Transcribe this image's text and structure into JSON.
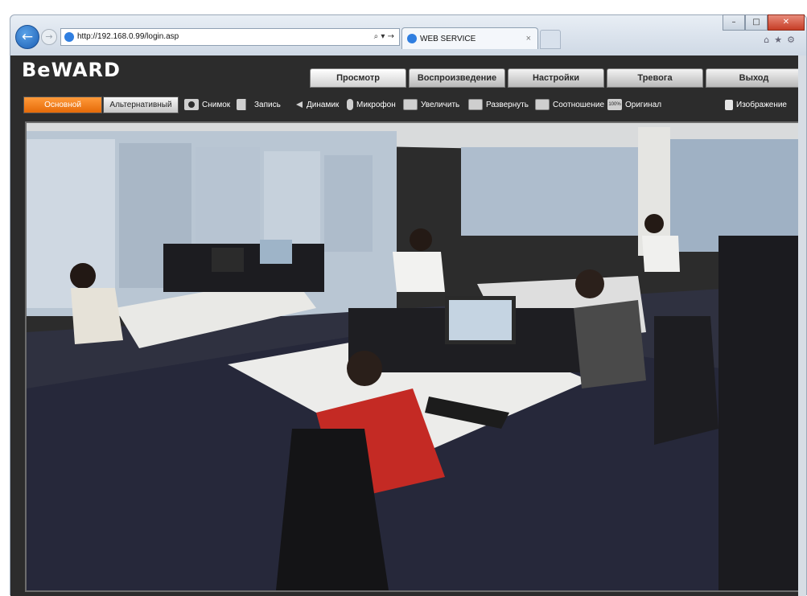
{
  "browser": {
    "url": "http://192.168.0.99/login.asp",
    "address_controls": "⌕ ▾ →",
    "tab_title": "WEB SERVICE",
    "tab_close": "×"
  },
  "app": {
    "logo": "BeWARD",
    "nav_tabs": [
      {
        "label": "Просмотр",
        "active": true
      },
      {
        "label": "Воспроизведение",
        "active": false
      },
      {
        "label": "Настройки",
        "active": false
      },
      {
        "label": "Тревога",
        "active": false
      },
      {
        "label": "Выход",
        "active": false
      }
    ],
    "stream": {
      "main_label": "Основной",
      "alt_label": "Альтернативный"
    },
    "tools": {
      "snapshot": "Снимок",
      "record": "Запись",
      "speaker": "Динамик",
      "mic": "Микрофон",
      "zoom": "Увеличить",
      "expand": "Развернуть",
      "ratio": "Соотношение",
      "original": "Оригинал",
      "original_icon_text": "100%",
      "image": "Изображение"
    }
  },
  "colors": {
    "accent_orange": "#f07c18",
    "panel_bg": "#2c2c2c",
    "browser_blue": "#1c5fb4"
  },
  "video_feed": {
    "icon": "office-camera-feed"
  }
}
